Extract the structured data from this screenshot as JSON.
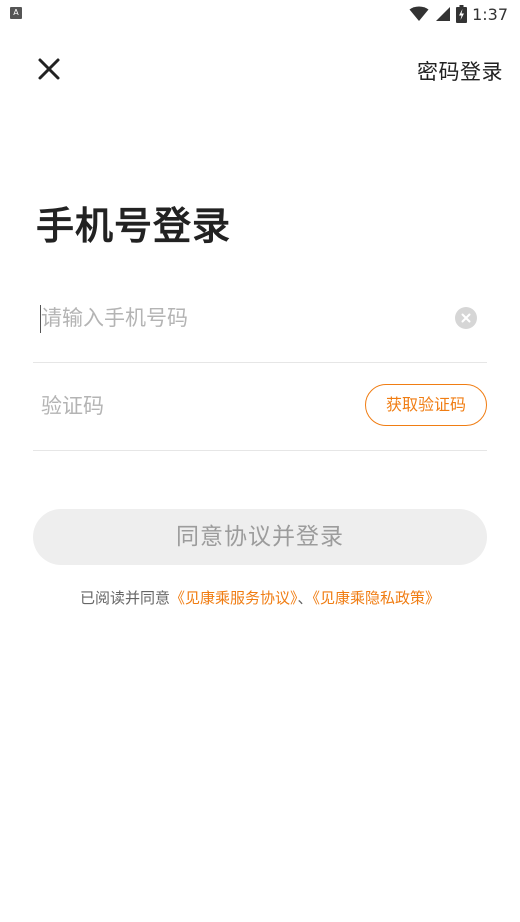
{
  "status_bar": {
    "left_icon": "A",
    "time": "1:37",
    "icons": [
      "wifi-icon",
      "signal-icon",
      "battery-charging-icon"
    ]
  },
  "header": {
    "close_icon": "close-icon",
    "password_login_label": "密码登录"
  },
  "title": "手机号登录",
  "phone_field": {
    "value": "",
    "placeholder": "请输入手机号码",
    "clear_icon": "clear-icon"
  },
  "code_field": {
    "value": "",
    "placeholder": "验证码",
    "get_code_label": "获取验证码"
  },
  "submit_label": "同意协议并登录",
  "agreement": {
    "prefix": "已阅读并同意",
    "service_link": "《见康乘服务协议》",
    "separator": "、",
    "privacy_link": "《见康乘隐私政策》"
  },
  "colors": {
    "accent": "#f07d13",
    "disabled_button_bg": "#eeeeee",
    "disabled_button_text": "#9c9c9c",
    "placeholder": "#b4b4b4",
    "divider": "#e6e6e6"
  }
}
